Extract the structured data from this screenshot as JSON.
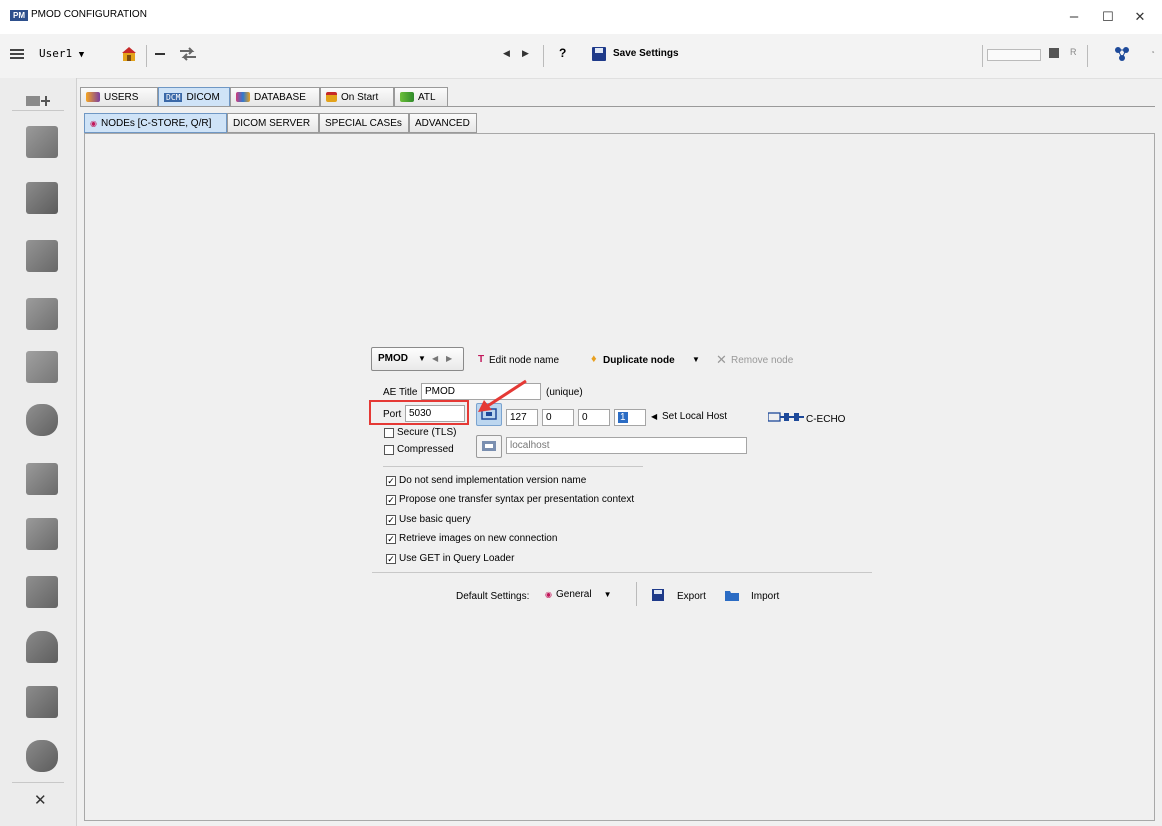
{
  "window": {
    "title": "PMOD CONFIGURATION",
    "logo_text": "PM",
    "minimize": "–",
    "maximize": "☐",
    "close": "✕"
  },
  "toolbar": {
    "user": "User1",
    "save_label": "Save Settings",
    "help": "?",
    "r_label": "R",
    "nav_prev": "◀",
    "nav_next": "▶"
  },
  "tabs": [
    {
      "label": "USERS",
      "prefix": ""
    },
    {
      "label": "DICOM",
      "prefix": "DCM"
    },
    {
      "label": "DATABASE",
      "prefix": ""
    },
    {
      "label": "On Start",
      "prefix": ""
    },
    {
      "label": "ATL",
      "prefix": ""
    }
  ],
  "subtabs": [
    "NODEs [C-STORE, Q/R]",
    "DICOM SERVER",
    "SPECIAL CASEs",
    "ADVANCED"
  ],
  "node": {
    "selected": "PMOD",
    "edit_name": "Edit node name",
    "duplicate": "Duplicate node",
    "remove": "Remove node",
    "ae_title_label": "AE Title",
    "ae_title": "PMOD",
    "unique": "(unique)",
    "port_label": "Port",
    "port": "5030",
    "ip": [
      "127",
      "0",
      "0",
      "1"
    ],
    "set_local_host": "Set Local Host",
    "cecho": "C-ECHO",
    "hostname": "localhost",
    "secure": "Secure (TLS)",
    "compressed": "Compressed"
  },
  "options": [
    {
      "label": "Do not send implementation version name",
      "checked": true
    },
    {
      "label": "Propose one transfer syntax per presentation context",
      "checked": true
    },
    {
      "label": "Use basic query",
      "checked": true
    },
    {
      "label": "Retrieve images on new connection",
      "checked": true
    },
    {
      "label": "Use GET in Query Loader",
      "checked": true
    }
  ],
  "defaults": {
    "label": "Default Settings:",
    "value": "General",
    "export": "Export",
    "import": "Import"
  },
  "colors": {
    "accent": "#cfe3f7",
    "highlight": "#e53935",
    "save_icon": "#1e3a8a"
  }
}
